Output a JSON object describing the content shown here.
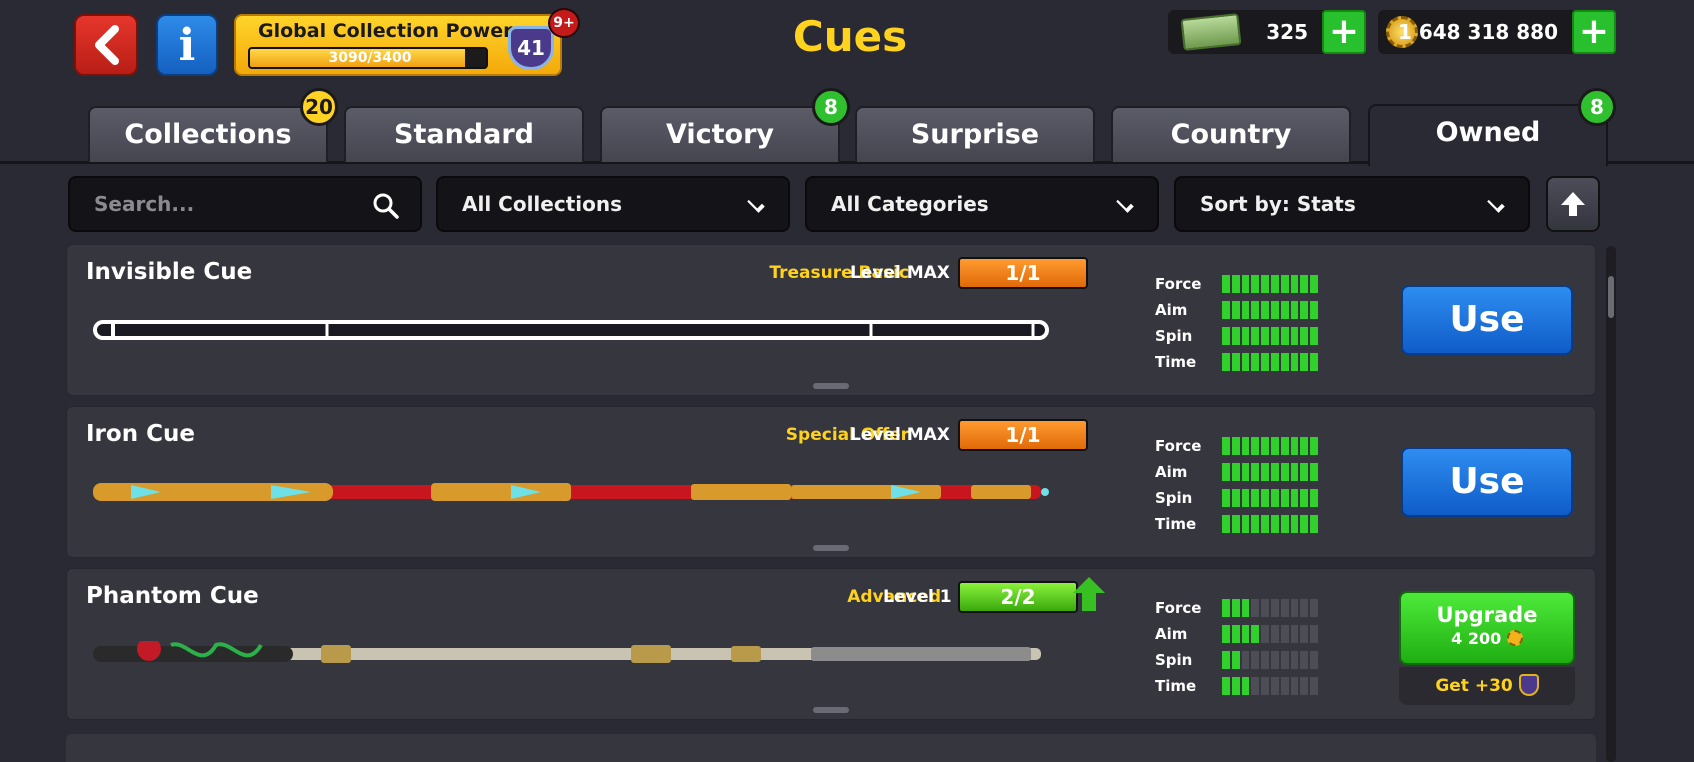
{
  "header": {
    "title": "Cues",
    "collection_power": {
      "label": "Global Collection Power",
      "value": "3090/3400",
      "progress": 0.91,
      "level": "41",
      "notification": "9+"
    },
    "cash": "325",
    "coins": "1 648 318 880",
    "plus_label": "+"
  },
  "tabs": [
    {
      "label": "Collections",
      "badge": "20"
    },
    {
      "label": "Standard"
    },
    {
      "label": "Victory",
      "badge": "8"
    },
    {
      "label": "Surprise"
    },
    {
      "label": "Country"
    },
    {
      "label": "Owned",
      "badge": "8",
      "active": true
    }
  ],
  "filters": {
    "search_placeholder": "Search...",
    "collections": "All Collections",
    "categories": "All Categories",
    "sort": "Sort by: Stats"
  },
  "stat_labels": [
    "Force",
    "Aim",
    "Spin",
    "Time"
  ],
  "cues": [
    {
      "name": "Invisible Cue",
      "category": "Treasure Basic",
      "level": "Level MAX",
      "progress": "1/1",
      "stats": [
        10,
        10,
        10,
        10
      ],
      "action": "Use"
    },
    {
      "name": "Iron Cue",
      "category": "Special Offer",
      "level": "Level MAX",
      "progress": "1/1",
      "stats": [
        10,
        10,
        10,
        10
      ],
      "action": "Use"
    },
    {
      "name": "Phantom Cue",
      "category": "Advanced",
      "level": "Level 1",
      "progress": "2/2",
      "stats": [
        3,
        4,
        2,
        3
      ],
      "action": "Upgrade",
      "upgrade_cost": "4 200",
      "reward": "Get +30"
    }
  ],
  "colors": {
    "accent_yellow": "#ffd21e",
    "use_blue": "#1f74de",
    "upgrade_green": "#2fc41e",
    "level_orange": "#f0821a"
  }
}
